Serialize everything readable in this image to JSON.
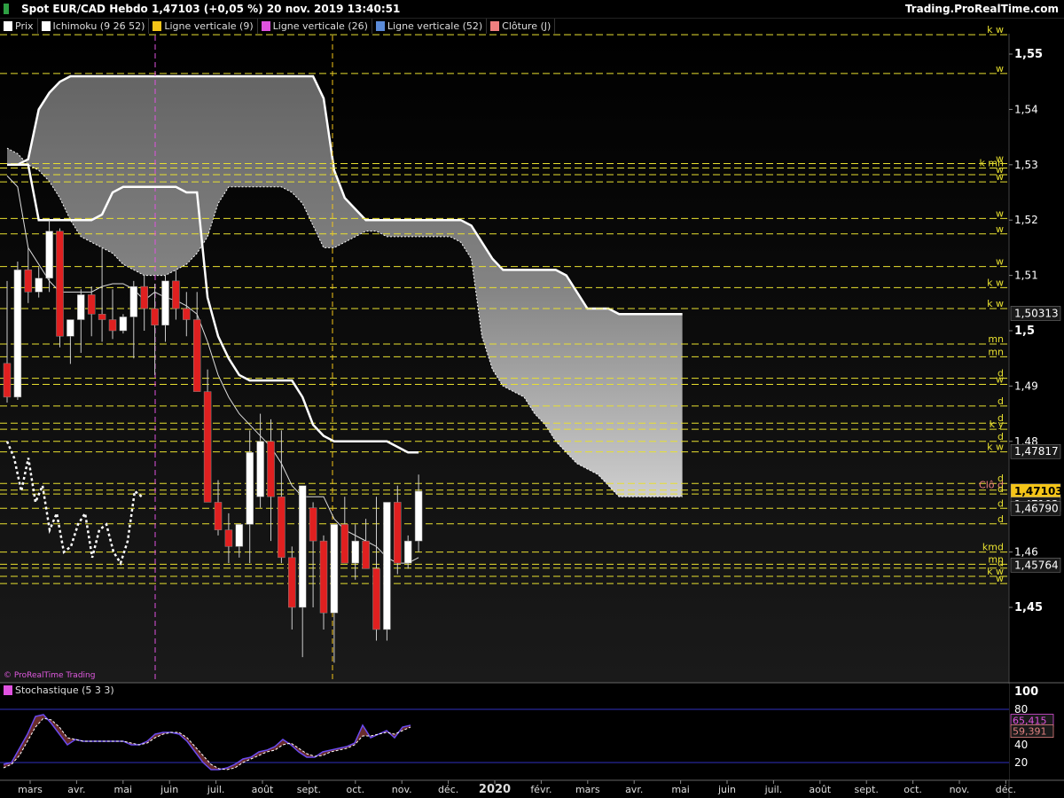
{
  "window": {
    "title": "Spot EUR/CAD Hebdo 1,47103 (+0,05 %) 20 nov. 2019 13:40:51",
    "brand": "Trading.ProRealTime.com",
    "watermark": "© ProRealTime Trading"
  },
  "legend": [
    {
      "label": "Prix",
      "color": "#ffffff",
      "icon": "candle-icon"
    },
    {
      "label": "Ichimoku (9 26 52)",
      "color": "#ffffff",
      "icon": "ichimoku-icon"
    },
    {
      "label": "Ligne verticale (9)",
      "color": "#f5c518",
      "icon": "vline-icon"
    },
    {
      "label": "Ligne verticale (26)",
      "color": "#e052e0",
      "icon": "vline-icon"
    },
    {
      "label": "Ligne verticale (52)",
      "color": "#5b8bd9",
      "icon": "vline-icon"
    },
    {
      "label": "Clôture (J)",
      "color": "#f08080",
      "icon": "close-icon"
    }
  ],
  "stoch_legend": {
    "label": "Stochastique (5 3 3)",
    "color": "#e052e0"
  },
  "price_axis": {
    "ticks": [
      "1,55",
      "1,54",
      "1,53",
      "1,52",
      "1,51",
      "1,5",
      "1,49",
      "1,48",
      "1,46",
      "1,45"
    ],
    "bold_ticks": [
      "1,55",
      "1,5",
      "1,45"
    ],
    "badges": [
      {
        "text": "1,50313",
        "value": 1.50313,
        "style": "dark"
      },
      {
        "text": "1,47817",
        "value": 1.47817,
        "style": "dark"
      },
      {
        "text": "1,47103",
        "value": 1.47103,
        "style": "gold"
      },
      {
        "text": "1,47103",
        "value": 1.47103,
        "style": "dark2"
      },
      {
        "text": "1,46790",
        "value": 1.4679,
        "style": "dark"
      },
      {
        "text": "1,45764",
        "value": 1.45764,
        "style": "dark"
      }
    ]
  },
  "level_lines": [
    {
      "value": 1.5535,
      "tag": "k w"
    },
    {
      "value": 1.5465,
      "tag": "w"
    },
    {
      "value": 1.5302,
      "tag": "w"
    },
    {
      "value": 1.5294,
      "tag": "k mn"
    },
    {
      "value": 1.5282,
      "tag": "w"
    },
    {
      "value": 1.5269,
      "tag": "w"
    },
    {
      "value": 1.5203,
      "tag": "w"
    },
    {
      "value": 1.5175,
      "tag": "w"
    },
    {
      "value": 1.5116,
      "tag": "w"
    },
    {
      "value": 1.5078,
      "tag": "k w"
    },
    {
      "value": 1.504,
      "tag": "k w"
    },
    {
      "value": 1.4976,
      "tag": "mn"
    },
    {
      "value": 1.4953,
      "tag": "mn"
    },
    {
      "value": 1.4914,
      "tag": "d"
    },
    {
      "value": 1.4903,
      "tag": "w"
    },
    {
      "value": 1.4864,
      "tag": "d"
    },
    {
      "value": 1.4833,
      "tag": "d"
    },
    {
      "value": 1.4822,
      "tag": "k y"
    },
    {
      "value": 1.48,
      "tag": "d"
    },
    {
      "value": 1.4781,
      "tag": "k w"
    },
    {
      "value": 1.4724,
      "tag": "d"
    },
    {
      "value": 1.4712,
      "tag": "Clô d"
    },
    {
      "value": 1.4705,
      "tag": "d"
    },
    {
      "value": 1.4679,
      "tag": "d"
    },
    {
      "value": 1.4651,
      "tag": "d"
    },
    {
      "value": 1.46,
      "tag": "kmd"
    },
    {
      "value": 1.4578,
      "tag": "mn"
    },
    {
      "value": 1.4571,
      "tag": "d"
    },
    {
      "value": 1.4556,
      "tag": "k w"
    },
    {
      "value": 1.4543,
      "tag": "w"
    }
  ],
  "time_axis": {
    "labels": [
      "mars",
      "avr.",
      "mai",
      "juin",
      "juil.",
      "août",
      "sept.",
      "oct.",
      "nov.",
      "déc.",
      "2020",
      "févr.",
      "mars",
      "avr.",
      "mai",
      "juin",
      "juil.",
      "août",
      "sept.",
      "oct.",
      "nov.",
      "déc."
    ],
    "bold_labels": [
      "2020"
    ]
  },
  "stoch_axis": {
    "ticks": [
      "100",
      "80",
      "60",
      "40",
      "20"
    ],
    "badges": [
      {
        "text": "65,415",
        "value": 65.415,
        "color": "#e052e0"
      },
      {
        "text": "59,391",
        "value": 59.391,
        "color": "#e08080"
      }
    ]
  },
  "chart_data": {
    "type": "candlestick",
    "title": "Spot EUR/CAD Hebdo",
    "y_range": [
      1.443,
      1.557
    ],
    "candles": [
      [
        1.4941,
        1.509,
        1.487,
        1.488
      ],
      [
        1.488,
        1.5125,
        1.4875,
        1.511
      ],
      [
        1.511,
        1.515,
        1.505,
        1.507
      ],
      [
        1.507,
        1.5115,
        1.506,
        1.5095
      ],
      [
        1.5095,
        1.52,
        1.507,
        1.518
      ],
      [
        1.518,
        1.5185,
        1.497,
        1.499
      ],
      [
        1.499,
        1.502,
        1.494,
        1.502
      ],
      [
        1.502,
        1.5075,
        1.496,
        1.5065
      ],
      [
        1.5065,
        1.508,
        1.499,
        1.503
      ],
      [
        1.503,
        1.515,
        1.498,
        1.502
      ],
      [
        1.502,
        1.5075,
        1.4985,
        1.5
      ],
      [
        1.5,
        1.503,
        1.4995,
        1.5025
      ],
      [
        1.5025,
        1.509,
        1.495,
        1.508
      ],
      [
        1.508,
        1.51,
        1.5,
        1.504
      ],
      [
        1.504,
        1.5085,
        1.492,
        1.501
      ],
      [
        1.501,
        1.51,
        1.498,
        1.509
      ],
      [
        1.509,
        1.511,
        1.502,
        1.504
      ],
      [
        1.504,
        1.507,
        1.499,
        1.502
      ],
      [
        1.502,
        1.507,
        1.49,
        1.489
      ],
      [
        1.489,
        1.493,
        1.473,
        1.469
      ],
      [
        1.469,
        1.473,
        1.463,
        1.464
      ],
      [
        1.464,
        1.467,
        1.458,
        1.461
      ],
      [
        1.461,
        1.465,
        1.459,
        1.465
      ],
      [
        1.465,
        1.482,
        1.458,
        1.478
      ],
      [
        1.47,
        1.485,
        1.468,
        1.48
      ],
      [
        1.48,
        1.484,
        1.462,
        1.47
      ],
      [
        1.47,
        1.482,
        1.458,
        1.459
      ],
      [
        1.459,
        1.461,
        1.446,
        1.45
      ],
      [
        1.45,
        1.472,
        1.441,
        1.472
      ],
      [
        1.468,
        1.469,
        1.45,
        1.462
      ],
      [
        1.462,
        1.463,
        1.446,
        1.449
      ],
      [
        1.449,
        1.465,
        1.44,
        1.465
      ],
      [
        1.465,
        1.47,
        1.458,
        1.458
      ],
      [
        1.458,
        1.465,
        1.455,
        1.462
      ],
      [
        1.462,
        1.466,
        1.457,
        1.457
      ],
      [
        1.457,
        1.47,
        1.444,
        1.446
      ],
      [
        1.446,
        1.469,
        1.444,
        1.469
      ],
      [
        1.469,
        1.472,
        1.456,
        1.458
      ],
      [
        1.458,
        1.463,
        1.457,
        1.462
      ],
      [
        1.462,
        1.474,
        1.46,
        1.471
      ]
    ],
    "kumo_span_a": [
      1.53,
      1.53,
      1.531,
      1.54,
      1.543,
      1.545,
      1.546,
      1.546,
      1.546,
      1.546,
      1.546,
      1.546,
      1.546,
      1.546,
      1.546,
      1.546,
      1.546,
      1.546,
      1.546,
      1.546,
      1.546,
      1.546,
      1.546,
      1.546,
      1.546,
      1.546,
      1.546,
      1.546,
      1.546,
      1.546,
      1.542,
      1.529,
      1.524,
      1.522,
      1.52,
      1.52,
      1.52,
      1.52,
      1.52,
      1.52,
      1.52,
      1.52,
      1.52,
      1.52,
      1.519,
      1.516,
      1.513,
      1.511,
      1.511,
      1.511,
      1.511,
      1.511,
      1.511,
      1.51,
      1.507,
      1.504,
      1.504,
      1.504,
      1.503,
      1.503,
      1.503,
      1.503,
      1.503,
      1.503,
      1.503
    ],
    "kumo_span_b": [
      1.533,
      1.532,
      1.53,
      1.529,
      1.527,
      1.524,
      1.52,
      1.517,
      1.516,
      1.515,
      1.514,
      1.512,
      1.511,
      1.51,
      1.51,
      1.51,
      1.511,
      1.512,
      1.514,
      1.517,
      1.523,
      1.526,
      1.526,
      1.526,
      1.526,
      1.526,
      1.526,
      1.525,
      1.523,
      1.519,
      1.515,
      1.515,
      1.516,
      1.517,
      1.518,
      1.518,
      1.517,
      1.517,
      1.517,
      1.517,
      1.517,
      1.517,
      1.517,
      1.516,
      1.513,
      1.499,
      1.493,
      1.49,
      1.489,
      1.488,
      1.485,
      1.483,
      1.48,
      1.478,
      1.476,
      1.475,
      1.474,
      1.472,
      1.47,
      1.47,
      1.47,
      1.47,
      1.47,
      1.47,
      1.47
    ],
    "kijun": [
      1.53,
      1.53,
      1.53,
      1.52,
      1.52,
      1.52,
      1.52,
      1.52,
      1.52,
      1.521,
      1.525,
      1.526,
      1.526,
      1.526,
      1.526,
      1.526,
      1.526,
      1.525,
      1.525,
      1.506,
      1.499,
      1.495,
      1.492,
      1.491,
      1.491,
      1.491,
      1.491,
      1.491,
      1.488,
      1.483,
      1.481,
      1.48,
      1.48,
      1.48,
      1.48,
      1.48,
      1.48,
      1.479,
      1.478,
      1.478
    ],
    "tenkan": [
      1.528,
      1.526,
      1.515,
      1.512,
      1.509,
      1.507,
      1.507,
      1.507,
      1.507,
      1.508,
      1.5085,
      1.5085,
      1.5075,
      1.5055,
      1.507,
      1.506,
      1.5055,
      1.5045,
      1.503,
      1.498,
      1.492,
      1.488,
      1.485,
      1.483,
      1.481,
      1.479,
      1.476,
      1.472,
      1.47,
      1.47,
      1.47,
      1.466,
      1.464,
      1.463,
      1.462,
      1.461,
      1.459,
      1.458,
      1.458,
      1.459
    ],
    "chikou": [
      1.48,
      1.477,
      1.471,
      1.477,
      1.469,
      1.472,
      1.464,
      1.467,
      1.46,
      1.461,
      1.465,
      1.467,
      1.459,
      1.464,
      1.465,
      1.46,
      1.458,
      1.462,
      1.471,
      1.47
    ],
    "stoch_k": [
      18,
      20,
      36,
      52,
      72,
      74,
      64,
      52,
      40,
      46,
      44,
      44,
      44,
      44,
      44,
      44,
      40,
      40,
      44,
      52,
      54,
      54,
      52,
      44,
      32,
      20,
      12,
      12,
      14,
      18,
      24,
      26,
      32,
      34,
      38,
      46,
      40,
      32,
      26,
      26,
      32,
      34,
      36,
      38,
      42,
      62,
      48,
      52,
      56,
      48,
      60,
      62
    ],
    "stoch_d": [
      14,
      18,
      28,
      44,
      60,
      70,
      68,
      60,
      48,
      46,
      44,
      44,
      44,
      44,
      44,
      44,
      42,
      40,
      42,
      48,
      52,
      54,
      54,
      48,
      38,
      28,
      18,
      13,
      12,
      14,
      20,
      24,
      28,
      32,
      34,
      40,
      42,
      36,
      30,
      27,
      28,
      32,
      34,
      36,
      40,
      50,
      50,
      52,
      54,
      52,
      56,
      60
    ]
  }
}
